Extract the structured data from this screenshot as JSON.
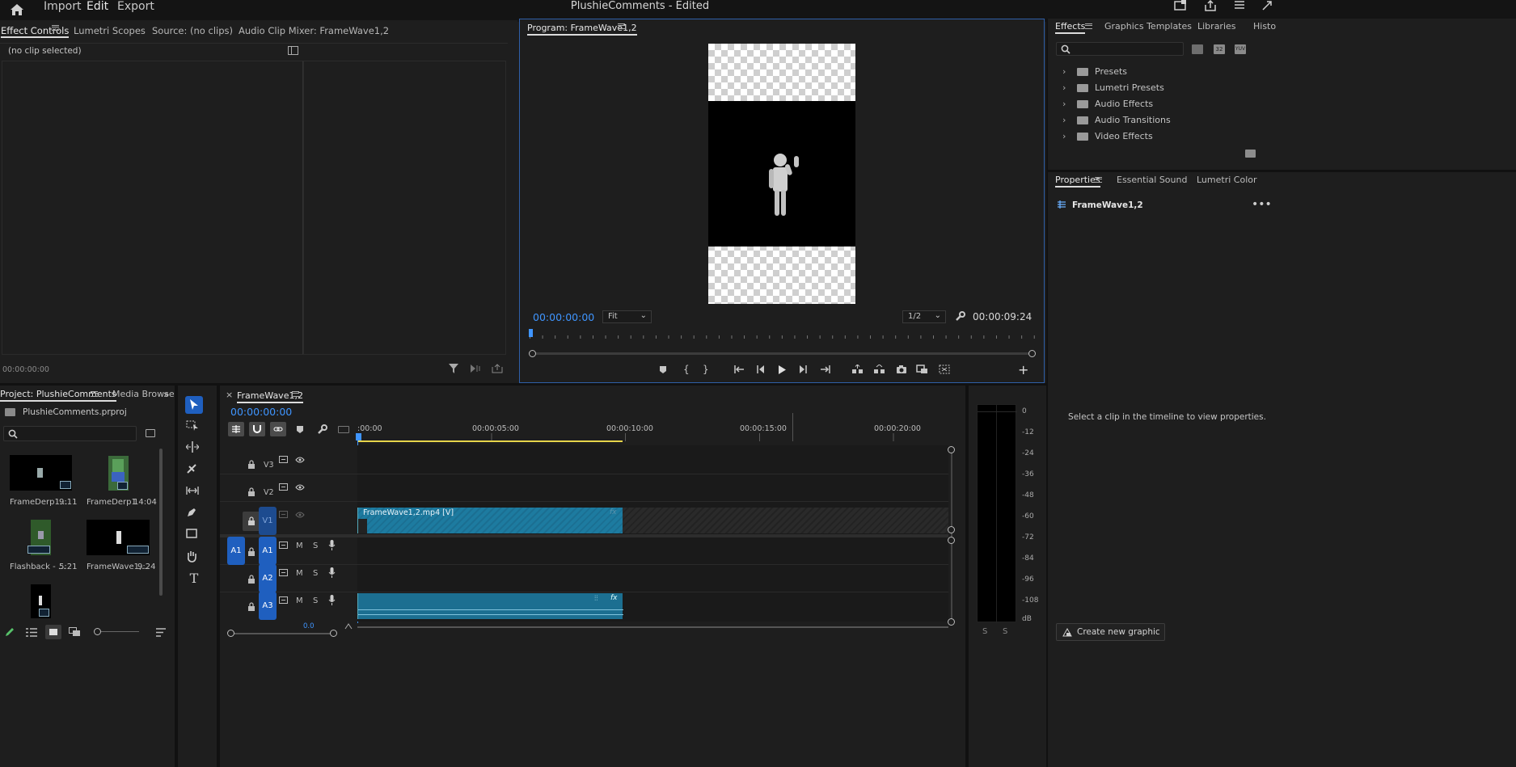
{
  "app": {
    "title": "PlushieComments - Edited",
    "menu": {
      "home": "home-icon",
      "import": "Import",
      "edit": "Edit",
      "export": "Export"
    }
  },
  "effect_controls": {
    "tabs": [
      "Effect Controls",
      "Lumetri Scopes",
      "Source: (no clips)",
      "Audio Clip Mixer: FrameWave1,2"
    ],
    "status": "(no clip selected)",
    "timecode": "00:00:00:00"
  },
  "program": {
    "tab": "Program: FrameWave1,2",
    "timecode": "00:00:00:00",
    "fit": "Fit",
    "resolution": "1/2",
    "duration": "00:00:09:24"
  },
  "effects": {
    "tabs": [
      "Effects",
      "Graphics Templates",
      "Libraries",
      "Histo"
    ],
    "search_placeholder": "",
    "filter_icons": [
      "32",
      "32",
      "YUV"
    ],
    "items": [
      "Presets",
      "Lumetri Presets",
      "Audio Effects",
      "Audio Transitions",
      "Video Effects"
    ]
  },
  "properties": {
    "tabs": [
      "Properties",
      "Essential Sound",
      "Lumetri Color"
    ],
    "selected": "FrameWave1,2",
    "hint": "Select a clip in the timeline to view properties.",
    "create_button": "Create new graphic"
  },
  "project": {
    "tabs": [
      "Project: PlushieComments",
      "Media Browse"
    ],
    "file": "PlushieComments.prproj",
    "items": [
      {
        "name": "FrameDerp1...",
        "duration": "9:11"
      },
      {
        "name": "FrameDerp1",
        "duration": "14:04"
      },
      {
        "name": "Flashback - ...",
        "duration": "5:21"
      },
      {
        "name": "FrameWave1,...",
        "duration": "9:24"
      }
    ]
  },
  "timeline": {
    "tab": "FrameWave1,2",
    "timecode": "00:00:00:00",
    "ruler": [
      ":00:00",
      "00:00:05:00",
      "00:00:10:00",
      "00:00:15:00",
      "00:00:20:00"
    ],
    "video_tracks": [
      "V3",
      "V2",
      "V1"
    ],
    "audio_tracks": [
      "A1",
      "A2",
      "A3"
    ],
    "source_patch": "A1",
    "track_buttons": {
      "mute": "M",
      "solo": "S"
    },
    "clip_video": "FrameWave1,2.mp4 [V]",
    "clip_fx": "fx",
    "bottom_value": "0.0"
  },
  "meter": {
    "scale": [
      "0",
      "-12",
      "-24",
      "-36",
      "-48",
      "-60",
      "-72",
      "-84",
      "-96",
      "-108",
      "dB"
    ],
    "solo": [
      "S",
      "S"
    ]
  }
}
